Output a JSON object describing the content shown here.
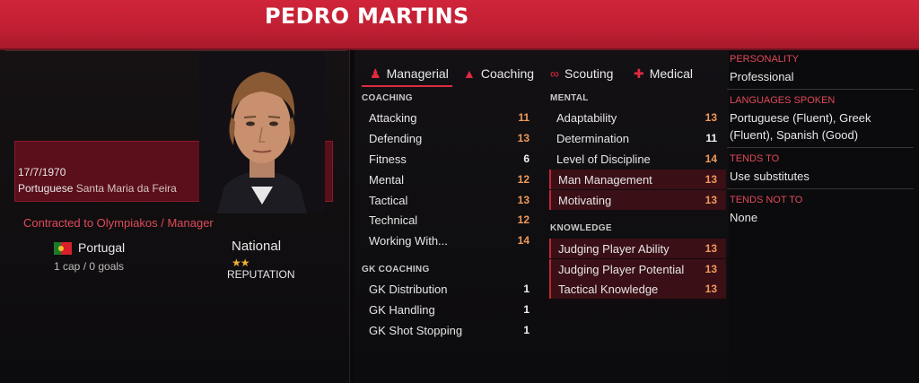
{
  "header": {
    "name": "PEDRO MARTINS"
  },
  "profile": {
    "dob": "17/7/1970",
    "nationality": "Portuguese",
    "birthplace": "Santa Maria da Feira",
    "club": "Contracted to Olympiakos",
    "separator": "/",
    "role": "Manager",
    "country": "Portugal",
    "caps": "1 cap / 0 goals",
    "reputation_level": "National",
    "reputation_stars": "★★",
    "reputation_label": "REPUTATION"
  },
  "tabs": [
    {
      "label": "Managerial",
      "icon": "person-icon"
    },
    {
      "label": "Coaching",
      "icon": "cone-icon"
    },
    {
      "label": "Scouting",
      "icon": "binoculars-icon"
    },
    {
      "label": "Medical",
      "icon": "medkit-icon"
    }
  ],
  "coaching": {
    "title": "COACHING",
    "rows": [
      {
        "label": "Attacking",
        "value": "11"
      },
      {
        "label": "Defending",
        "value": "13"
      },
      {
        "label": "Fitness",
        "value": "6"
      },
      {
        "label": "Mental",
        "value": "12"
      },
      {
        "label": "Tactical",
        "value": "13"
      },
      {
        "label": "Technical",
        "value": "12"
      },
      {
        "label": "Working With...",
        "value": "14"
      }
    ]
  },
  "gk_coaching": {
    "title": "GK COACHING",
    "rows": [
      {
        "label": "GK Distribution",
        "value": "1"
      },
      {
        "label": "GK Handling",
        "value": "1"
      },
      {
        "label": "GK Shot Stopping",
        "value": "1"
      }
    ]
  },
  "mental": {
    "title": "MENTAL",
    "rows": [
      {
        "label": "Adaptability",
        "value": "13"
      },
      {
        "label": "Determination",
        "value": "11"
      },
      {
        "label": "Level of Discipline",
        "value": "14"
      },
      {
        "label": "Man Management",
        "value": "13"
      },
      {
        "label": "Motivating",
        "value": "13"
      }
    ]
  },
  "knowledge": {
    "title": "KNOWLEDGE",
    "rows": [
      {
        "label": "Judging Player Ability",
        "value": "13"
      },
      {
        "label": "Judging Player Potential",
        "value": "13"
      },
      {
        "label": "Tactical Knowledge",
        "value": "13"
      }
    ]
  },
  "right": {
    "personality_label": "PERSONALITY",
    "personality": "Professional",
    "languages_label": "LANGUAGES SPOKEN",
    "languages": "Portuguese (Fluent), Greek (Fluent), Spanish (Good)",
    "tends_to_label": "TENDS TO",
    "tends_to": "Use substitutes",
    "tends_not_label": "TENDS NOT TO",
    "tends_not": "None"
  },
  "colors": {
    "accent": "#e02a40",
    "header": "#c8223a",
    "highlight": "#3a0f16",
    "value_orange": "#f09a5a"
  }
}
